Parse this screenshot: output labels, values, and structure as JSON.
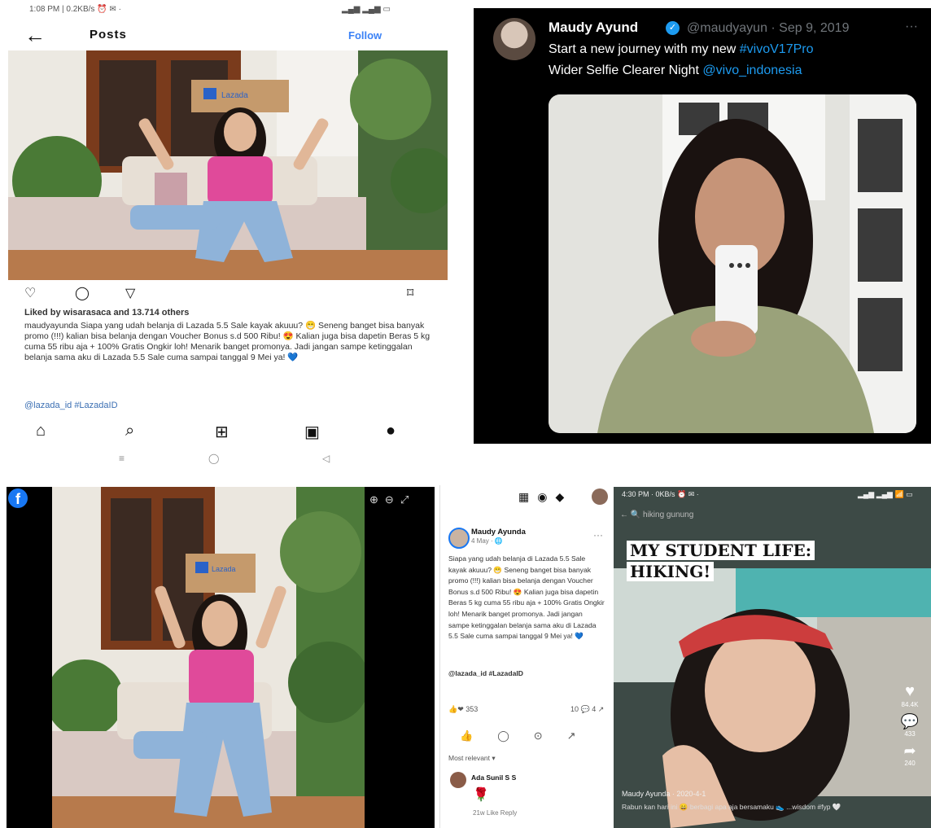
{
  "instagram": {
    "status_left": "1:08 PM | 0.2KB/s ⏰ ✉ ·",
    "status_right": "▂▄▆ ▂▄▆ ▭",
    "back_icon": "arrow-left-icon",
    "header_title": "Posts",
    "follow_label": "Follow",
    "likes_text": "Liked by wisarasaca and 13.714 others",
    "caption": "maudyayunda Siapa yang udah belanja di Lazada 5.5 Sale kayak akuuu? 😁 Seneng banget bisa banyak promo (!!!) kalian bisa belanja dengan Voucher Bonus s.d 500 Ribu! 😍 Kalian juga bisa dapetin Beras 5 kg cuma 55 ribu aja + 100% Gratis Ongkir loh! Menarik banget promonya. Jadi jangan sampe ketinggalan belanja sama aku di Lazada 5.5 Sale cuma sampai tanggal 9 Mei ya! 💙",
    "tags": "@lazada_id #LazadaID",
    "box_label": "Lazada",
    "system_nav": [
      "≡",
      "◯",
      "◁"
    ]
  },
  "twitter": {
    "name": "Maudy Ayund",
    "handle": "@maudyayun · Sep 9, 2019",
    "more": "···",
    "text_line1_prefix": "Start a new journey with my new ",
    "text_line1_hashtag": "#vivoV17Pro",
    "text_line2_prefix": "Wider Selfie Clearer Night ",
    "text_line2_mention": "@vivo_indonesia"
  },
  "facebook_photo": {
    "logo": "f",
    "box_label": "Lazada"
  },
  "facebook_post": {
    "author": "Maudy Ayunda",
    "time": "4 May · 🌐",
    "more": "···",
    "text": "Siapa yang udah belanja di Lazada 5.5 Sale kayak akuuu? 😁 Seneng banget bisa banyak promo (!!!) kalian bisa belanja dengan Voucher Bonus s.d 500 Ribu! 😍 Kalian juga bisa dapetin Beras 5 kg cuma 55 ribu aja + 100% Gratis Ongkir loh! Menarik banget promonya. Jadi jangan sampe ketinggalan belanja sama aku di Lazada 5.5 Sale cuma sampai tanggal 9 Mei ya! 💙",
    "tags": "@lazada_id #LazadaID",
    "reactions_left": "👍❤ 353",
    "reactions_right": "10 💬 4 ↗",
    "sort_label": "Most relevant ▾",
    "commenter": "Ada Sunil S S",
    "comment_emoji": "🌹",
    "comment_actions": "21w   Like   Reply"
  },
  "tiktok": {
    "status_left": "4:30 PM · 0KB/s ⏰ ✉ ·",
    "status_right": "▂▄▆ ▂▄▆ 📶 ▭",
    "search_text": "←   🔍 hiking gunung",
    "caption_line1": "MY STUDENT LIFE:",
    "caption_line2": "HIKING!",
    "like_count": "84.4K",
    "comment_count": "433",
    "share_count": "240",
    "author": "Maudy Ayunda · 2020-4-1",
    "description": "Rabun kan hari ini 😄 berbagi apa aja bersamaku 👟 ...wisdom #fyp 🤍"
  }
}
